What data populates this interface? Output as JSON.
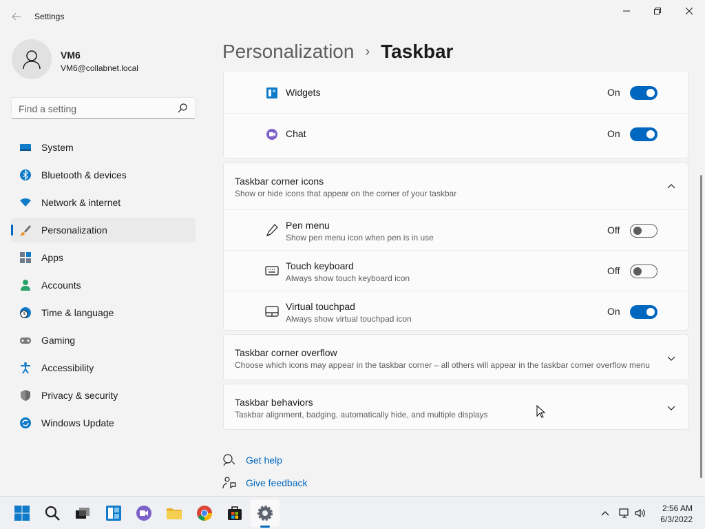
{
  "window": {
    "app_title": "Settings",
    "back_icon": "back-arrow-icon",
    "controls": [
      "minimize-icon",
      "maximize-icon",
      "close-icon"
    ]
  },
  "user": {
    "name": "VM6",
    "email": "VM6@collabnet.local"
  },
  "search": {
    "placeholder": "Find a setting"
  },
  "sidebar": {
    "items": [
      {
        "label": "System",
        "icon": "monitor-icon",
        "active": false
      },
      {
        "label": "Bluetooth & devices",
        "icon": "bluetooth-icon",
        "active": false
      },
      {
        "label": "Network & internet",
        "icon": "wifi-icon",
        "active": false
      },
      {
        "label": "Personalization",
        "icon": "brush-icon",
        "active": true
      },
      {
        "label": "Apps",
        "icon": "apps-icon",
        "active": false
      },
      {
        "label": "Accounts",
        "icon": "person-icon",
        "active": false
      },
      {
        "label": "Time & language",
        "icon": "globe-clock-icon",
        "active": false
      },
      {
        "label": "Gaming",
        "icon": "gamepad-icon",
        "active": false
      },
      {
        "label": "Accessibility",
        "icon": "accessibility-icon",
        "active": false
      },
      {
        "label": "Privacy & security",
        "icon": "shield-icon",
        "active": false
      },
      {
        "label": "Windows Update",
        "icon": "update-icon",
        "active": false
      }
    ]
  },
  "header": {
    "parent": "Personalization",
    "separator": "›",
    "current": "Taskbar"
  },
  "taskbar_items": {
    "rows": [
      {
        "title": "Widgets",
        "state": "On",
        "on": true,
        "icon": "widgets-icon"
      },
      {
        "title": "Chat",
        "state": "On",
        "on": true,
        "icon": "chat-icon"
      }
    ]
  },
  "corner_icons": {
    "title": "Taskbar corner icons",
    "description": "Show or hide icons that appear on the corner of your taskbar",
    "rows": [
      {
        "title": "Pen menu",
        "description": "Show pen menu icon when pen is in use",
        "state": "Off",
        "on": false,
        "icon": "pen-icon"
      },
      {
        "title": "Touch keyboard",
        "description": "Always show touch keyboard icon",
        "state": "Off",
        "on": false,
        "icon": "keyboard-icon"
      },
      {
        "title": "Virtual touchpad",
        "description": "Always show virtual touchpad icon",
        "state": "On",
        "on": true,
        "icon": "touchpad-icon"
      }
    ]
  },
  "corner_overflow": {
    "title": "Taskbar corner overflow",
    "description": "Choose which icons may appear in the taskbar corner – all others will appear in the taskbar corner overflow menu"
  },
  "behaviors": {
    "title": "Taskbar behaviors",
    "description": "Taskbar alignment, badging, automatically hide, and multiple displays"
  },
  "links": {
    "help": "Get help",
    "feedback": "Give feedback"
  },
  "os_taskbar": {
    "apps": [
      "start-icon",
      "search-icon",
      "task-view-icon",
      "widgets-icon",
      "teams-chat-icon",
      "file-explorer-icon",
      "chrome-icon",
      "store-icon",
      "settings-icon"
    ],
    "clock_time": "2:56 AM",
    "clock_date": "6/3/2022"
  },
  "colors": {
    "accent": "#0067c0",
    "background": "#f3f3f3",
    "card": "#fbfbfb"
  }
}
